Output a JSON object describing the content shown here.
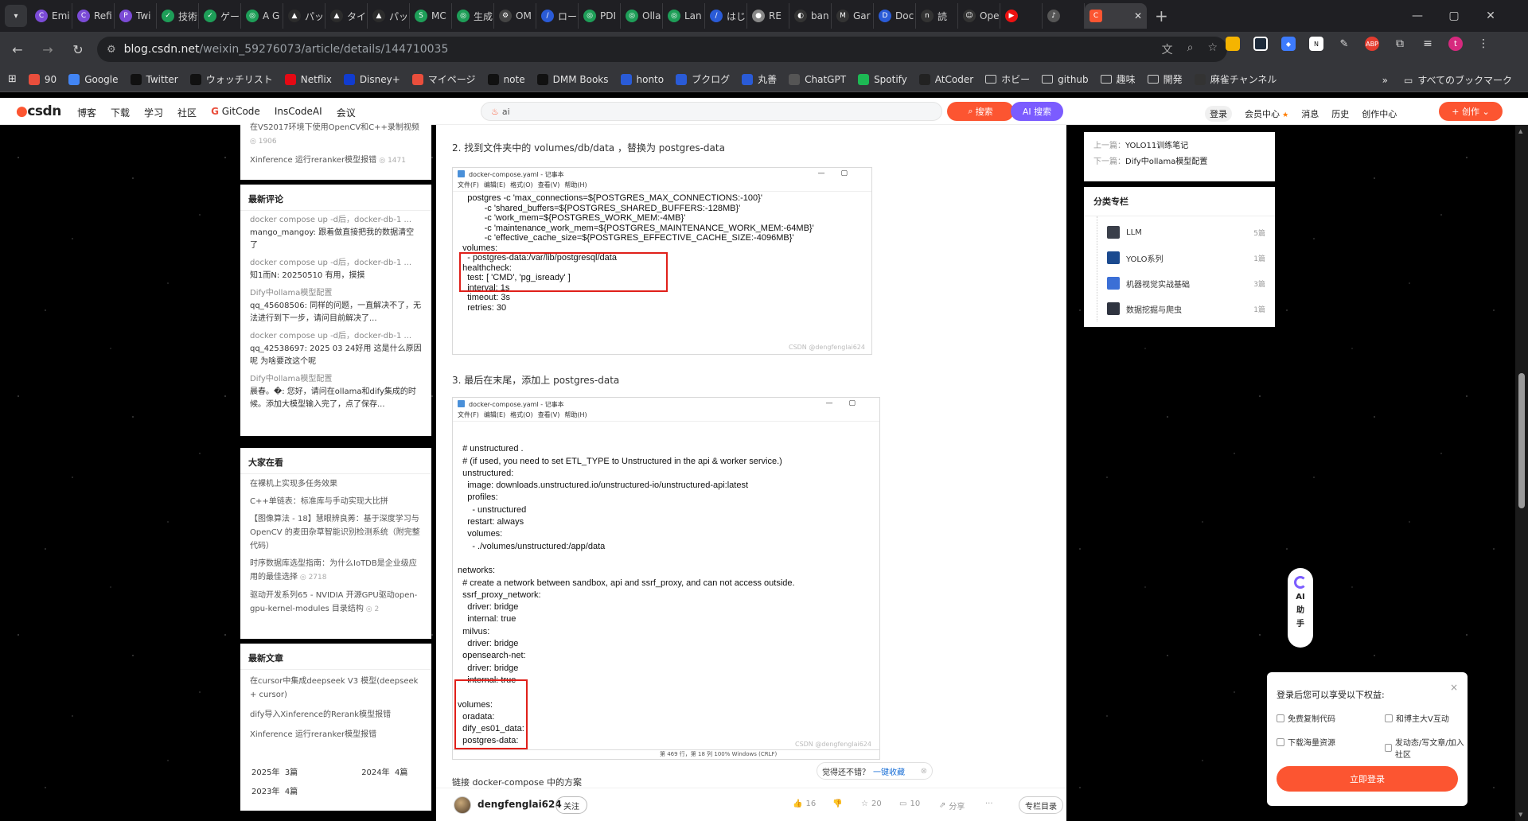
{
  "browser": {
    "tabs": [
      {
        "label": "Emi",
        "color": "#7b4bd6",
        "glyph": "C"
      },
      {
        "label": "Refi",
        "color": "#7b4bd6",
        "glyph": "C"
      },
      {
        "label": "Twi",
        "color": "#7b4bd6",
        "glyph": "P"
      },
      {
        "label": "技術",
        "color": "#1e9e58",
        "glyph": "✓"
      },
      {
        "label": "ゲー",
        "color": "#1e9e58",
        "glyph": "✓"
      },
      {
        "label": "A G",
        "color": "#1e9e58",
        "glyph": "◎"
      },
      {
        "label": "パッ",
        "color": "#2c2c2c",
        "glyph": "▲"
      },
      {
        "label": "タイ",
        "color": "#2c2c2c",
        "glyph": "▲"
      },
      {
        "label": "パッ",
        "color": "#2c2c2c",
        "glyph": "▲"
      },
      {
        "label": "MC",
        "color": "#1e9e58",
        "glyph": "S"
      },
      {
        "label": "生成",
        "color": "#1e9e58",
        "glyph": "◎"
      },
      {
        "label": "OM",
        "color": "#444",
        "glyph": "⚙"
      },
      {
        "label": "ロー",
        "color": "#2a5bd7",
        "glyph": "/"
      },
      {
        "label": "PDI",
        "color": "#1e9e58",
        "glyph": "◎"
      },
      {
        "label": "Olla",
        "color": "#1e9e58",
        "glyph": "◎"
      },
      {
        "label": "Lan",
        "color": "#1e9e58",
        "glyph": "◎"
      },
      {
        "label": "はじ",
        "color": "#2a5bd7",
        "glyph": "/"
      },
      {
        "label": "RE",
        "color": "#888",
        "glyph": "●"
      },
      {
        "label": "ban",
        "color": "#333",
        "glyph": "◐"
      },
      {
        "label": "Gar",
        "color": "#333",
        "glyph": "M"
      },
      {
        "label": "Doc",
        "color": "#2a5bd7",
        "glyph": "D"
      },
      {
        "label": "読",
        "color": "#333",
        "glyph": "n"
      },
      {
        "label": "Ope",
        "color": "#333",
        "glyph": "☺"
      },
      {
        "label": "",
        "color": "#e11",
        "glyph": "▶"
      },
      {
        "label": "",
        "color": "#555",
        "glyph": "♪"
      }
    ],
    "active_tab": {
      "label": "",
      "color": "#fc5531",
      "glyph": "C"
    },
    "url_host": "blog.csdn.net",
    "url_path": "/weixin_59276073/article/details/144710035",
    "profile_initial": "t",
    "bookmarks": [
      {
        "label": "90",
        "color": "#e94e3c"
      },
      {
        "label": "Google",
        "color": "#4285f4"
      },
      {
        "label": "Twitter",
        "color": "#111"
      },
      {
        "label": "ウォッチリスト",
        "color": "#111"
      },
      {
        "label": "Netflix",
        "color": "#e50914"
      },
      {
        "label": "Disney+",
        "color": "#113ccf"
      },
      {
        "label": "マイページ",
        "color": "#e94e3c"
      },
      {
        "label": "note",
        "color": "#111"
      },
      {
        "label": "DMM Books",
        "color": "#111"
      },
      {
        "label": "honto",
        "color": "#2a5bd7"
      },
      {
        "label": "ブクログ",
        "color": "#2a5bd7"
      },
      {
        "label": "丸善",
        "color": "#2a5bd7"
      },
      {
        "label": "ChatGPT",
        "color": "#555"
      },
      {
        "label": "Spotify",
        "color": "#1db954"
      },
      {
        "label": "AtCoder",
        "color": "#222"
      },
      {
        "label": "ホビー",
        "color": "folder"
      },
      {
        "label": "github",
        "color": "folder"
      },
      {
        "label": "趣味",
        "color": "folder"
      },
      {
        "label": "開発",
        "color": "folder"
      },
      {
        "label": "麻雀チャンネル",
        "color": "#333"
      }
    ],
    "all_bookmarks": "すべてのブックマーク"
  },
  "csdn": {
    "nav": [
      "博客",
      "下载",
      "学习",
      "社区"
    ],
    "gitcode": "GitCode",
    "inscode": "InsCodeAI",
    "meeting": "会议",
    "search_value": "ai",
    "search_btn": "搜索",
    "ai_search_btn": "AI 搜索",
    "login": "登录",
    "vip": "会员中心",
    "messages": "消息",
    "history": "历史",
    "creator": "创作中心",
    "create_btn": "创作"
  },
  "left": {
    "top_items": [
      {
        "text": "在VS2017环境下使用OpenCV和C++录制视频",
        "count": "1906"
      },
      {
        "text": "Xinference 运行reranker模型报错",
        "count": "1471"
      }
    ],
    "comments_title": "最新评论",
    "comments": [
      {
        "title": "docker compose up -d后，docker-db-1 ...",
        "body": "mango_mangoy: 跟着做直接把我的数据清空了"
      },
      {
        "title": "docker compose up -d后，docker-db-1 ...",
        "body": "知1而N: 20250510 有用，摸摸"
      },
      {
        "title": "Dify中ollama模型配置",
        "body": "qq_45608506: 同样的问题，一直解决不了，无法进行到下一步，请问目前解决了..."
      },
      {
        "title": "docker compose up -d后，docker-db-1 ...",
        "body": "qq_42538697: 2025 03 24好用 这是什么原因呢 为啥要改这个呢"
      },
      {
        "title": "Dify中ollama模型配置",
        "body": "晨春。�: 您好，请问在ollama和dify集成的时候。添加大模型输入完了，点了保存..."
      }
    ],
    "popular_title": "大家在看",
    "popular": [
      {
        "text": "在裸机上实现多任务效果",
        "count": ""
      },
      {
        "text": "C++单链表：标准库与手动实现大比拼",
        "count": ""
      },
      {
        "text": "【图像算法 - 18】慧眼辨良莠：基于深度学习与 OpenCV 的麦田杂草智能识别检测系统（附完整代码）",
        "count": ""
      },
      {
        "text": "时序数据库选型指南：为什么IoTDB是企业级应用的最佳选择",
        "count": "2718"
      },
      {
        "text": "驱动开发系列65 - NVIDIA 开源GPU驱动open-gpu-kernel-modules 目录结构",
        "count": "2"
      }
    ],
    "latest_title": "最新文章",
    "latest": [
      "在cursor中集成deepseek V3 模型(deepseek + cursor)",
      "dify导入Xinference的Rerank模型报错",
      "Xinference 运行reranker模型报错"
    ],
    "archive": [
      {
        "label": "2025年",
        "count": "3篇"
      },
      {
        "label": "2024年",
        "count": "4篇"
      },
      {
        "label": "2023年",
        "count": "4篇"
      }
    ]
  },
  "article": {
    "step2": "2. 找到文件夹中的 volumes/db/data ，替换为 postgres-data",
    "step3": "3. 最后在末尾，添加上 postgres-data",
    "shot1": {
      "title": "docker-compose.yaml - 记事本",
      "menu": [
        "文件(F)",
        "编辑(E)",
        "格式(O)",
        "查看(V)",
        "帮助(H)"
      ],
      "code": "    postgres -c 'max_connections=${POSTGRES_MAX_CONNECTIONS:-100}'\n           -c 'shared_buffers=${POSTGRES_SHARED_BUFFERS:-128MB}'\n           -c 'work_mem=${POSTGRES_WORK_MEM:-4MB}'\n           -c 'maintenance_work_mem=${POSTGRES_MAINTENANCE_WORK_MEM:-64MB}'\n           -c 'effective_cache_size=${POSTGRES_EFFECTIVE_CACHE_SIZE:-4096MB}'\n  volumes:\n    - postgres-data:/var/lib/postgresql/data\n  healthcheck:\n    test: [ 'CMD', 'pg_isready' ]\n    interval: 1s\n    timeout: 3s\n    retries: 30",
      "watermark": "CSDN @dengfenglai624"
    },
    "shot2": {
      "title": "docker-compose.yaml - 记事本",
      "menu": [
        "文件(F)",
        "编辑(E)",
        "格式(O)",
        "查看(V)",
        "帮助(H)"
      ],
      "code": "\n  # unstructured .\n  # (if used, you need to set ETL_TYPE to Unstructured in the api & worker service.)\n  unstructured:\n    image: downloads.unstructured.io/unstructured-io/unstructured-api:latest\n    profiles:\n      - unstructured\n    restart: always\n    volumes:\n      - ./volumes/unstructured:/app/data\n\nnetworks:\n  # create a network between sandbox, api and ssrf_proxy, and can not access outside.\n  ssrf_proxy_network:\n    driver: bridge\n    internal: true\n  milvus:\n    driver: bridge\n  opensearch-net:\n    driver: bridge\n    internal: true\n\nvolumes:\n  oradata:\n  dify_es01_data:\n  postgres-data:",
      "status": "第 469 行，第 18 列     100%     Windows (CRLF)",
      "watermark": "CSDN @dengfenglai624"
    },
    "cutoff_text": "链接 docker-compose 中的方案"
  },
  "like_bubble": {
    "text": "觉得还不错？",
    "link": "一键收藏"
  },
  "author": {
    "name": "dengfenglai624",
    "follow": "关注",
    "likes": "16",
    "stars": "20",
    "comments": "10",
    "share": "分享",
    "more": "···",
    "column_btn": "专栏目录"
  },
  "right": {
    "prev_label": "上一篇：",
    "prev_title": "YOLO11训练笔记",
    "next_label": "下一篇：",
    "next_title": "Dify中ollama模型配置",
    "columns_title": "分类专栏",
    "columns": [
      {
        "name": "LLM",
        "count": "5篇",
        "color": "#3a3f4a"
      },
      {
        "name": "YOLO系列",
        "count": "1篇",
        "color": "#1b4a8f"
      },
      {
        "name": "机器视觉实战基础",
        "count": "3篇",
        "color": "#3b6fd6"
      },
      {
        "name": "数据挖掘与爬虫",
        "count": "1篇",
        "color": "#2f3440"
      }
    ]
  },
  "ai_float": {
    "lines": [
      "AI",
      "助",
      "手"
    ]
  },
  "login_popup": {
    "title": "登录后您可以享受以下权益:",
    "perks": [
      "免费复制代码",
      "和博主大V互动",
      "下载海量资源",
      "发动态/写文章/加入社区"
    ],
    "button": "立即登录",
    "close": "×"
  }
}
